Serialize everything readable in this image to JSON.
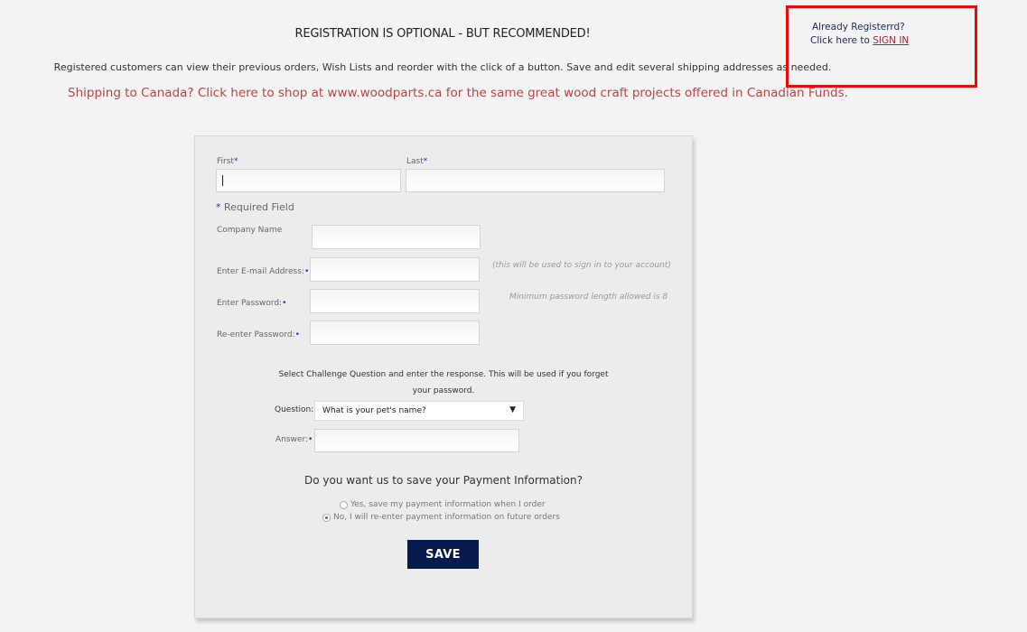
{
  "header": {
    "heading": "REGISTRATION IS OPTIONAL - BUT RECOMMENDED!",
    "intro": "Registered customers can view their previous orders, Wish Lists and reorder with the click of a button. Save and edit several shipping addresses as needed.",
    "canada_link": "Shipping to Canada? Click here to shop at www.woodparts.ca for the same great wood craft projects offered in Canadian Funds."
  },
  "signin": {
    "line1": "Already Registerrd?",
    "line2_prefix": "Click here to ",
    "link": "SIGN IN",
    "highlight_color": "#e8080e"
  },
  "form": {
    "first_label": "First",
    "last_label": "Last",
    "required_mark": "*",
    "required_note": "Required Field",
    "company_label": "Company Name",
    "email_label": "Enter E-mail Address:",
    "email_hint": "(this will be used to sign in to your account)",
    "password_label": "Enter Password:",
    "password_hint": "Minimum password length allowed is 8",
    "reenter_label": "Re-enter Password:",
    "first_value": "",
    "last_value": "",
    "company_value": "",
    "email_value": "",
    "password_value": "",
    "reenter_value": "",
    "challenge_text_1": "Select Challenge Question and enter the response. This will be used if you forget",
    "challenge_text_2": "your password.",
    "question_label": "Question:",
    "question_selected": "What is your pet's name?",
    "answer_label": "Answer:",
    "answer_value": "",
    "payment_question": "Do you want us to save your Payment Information?",
    "payment_options": [
      {
        "label": "Yes, save my payment information when I order",
        "checked": false
      },
      {
        "label": "No, I will re-enter payment information on future orders",
        "checked": true
      }
    ],
    "save_label": "SAVE",
    "save_color": "#061a4d"
  }
}
